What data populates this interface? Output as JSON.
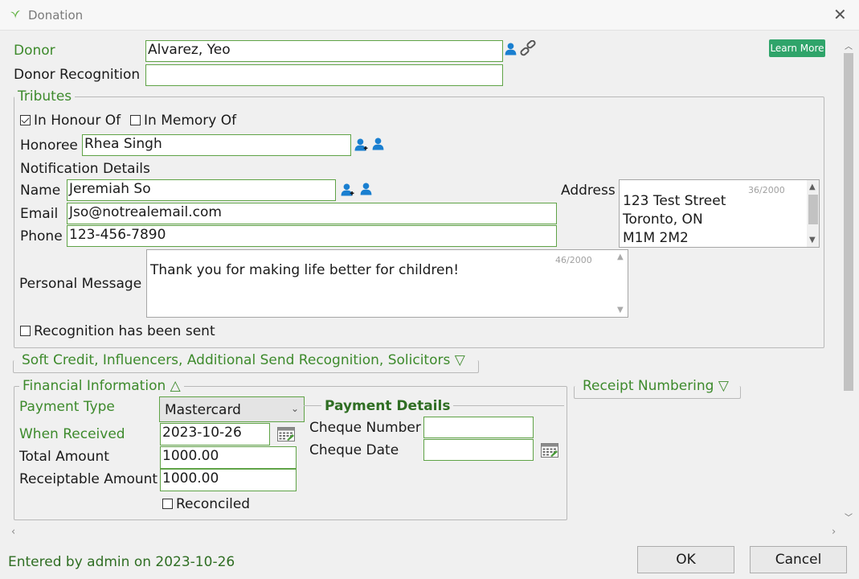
{
  "window": {
    "title": "Donation"
  },
  "donor": {
    "label": "Donor",
    "value": "Alvarez, Yeo"
  },
  "donor_recognition": {
    "label": "Donor Recognition",
    "value": ""
  },
  "learn_more": "Learn More",
  "tributes": {
    "legend": "Tributes",
    "in_honour_label": "In Honour Of",
    "in_honour_checked": true,
    "in_memory_label": "In Memory Of",
    "in_memory_checked": false,
    "honoree_label": "Honoree",
    "honoree_value": "Rhea Singh",
    "notification_heading": "Notification Details",
    "name_label": "Name",
    "name_value": "Jeremiah So",
    "email_label": "Email",
    "email_value": "Jso@notrealemail.com",
    "phone_label": "Phone",
    "phone_value": "123-456-7890",
    "address_label": "Address",
    "address_lines": [
      "123 Test Street",
      "Toronto, ON",
      "M1M 2M2"
    ],
    "address_counter": "36/2000",
    "personal_message_label": "Personal Message",
    "personal_message_value": "Thank you for making life better for children!",
    "message_counter": "46/2000",
    "recognition_sent_label": "Recognition has been sent",
    "recognition_sent_checked": false
  },
  "soft_credit": {
    "legend": "Soft Credit, Influencers, Additional Send Recognition, Solicitors ▽"
  },
  "financial": {
    "legend": "Financial Information △",
    "payment_type_label": "Payment Type",
    "payment_type_value": "Mastercard",
    "when_received_label": "When Received",
    "when_received_value": "2023-10-26",
    "total_amount_label": "Total Amount",
    "total_amount_value": "1000.00",
    "receiptable_label": "Receiptable Amount",
    "receiptable_value": "1000.00",
    "reconciled_label": "Reconciled",
    "reconciled_checked": false,
    "payment_details_heading": "Payment Details",
    "cheque_number_label": "Cheque Number",
    "cheque_number_value": "",
    "cheque_date_label": "Cheque Date",
    "cheque_date_value": ""
  },
  "receipt_numbering": {
    "legend": "Receipt Numbering ▽"
  },
  "footer": {
    "entered_by": "Entered by admin on 2023-10-26",
    "ok_label": "OK",
    "cancel_label": "Cancel"
  },
  "colors": {
    "accent_green": "#3d8a2c",
    "field_border": "#5fa346",
    "learn_more_bg": "#2fa46a",
    "person_icon": "#1a7fd0"
  }
}
